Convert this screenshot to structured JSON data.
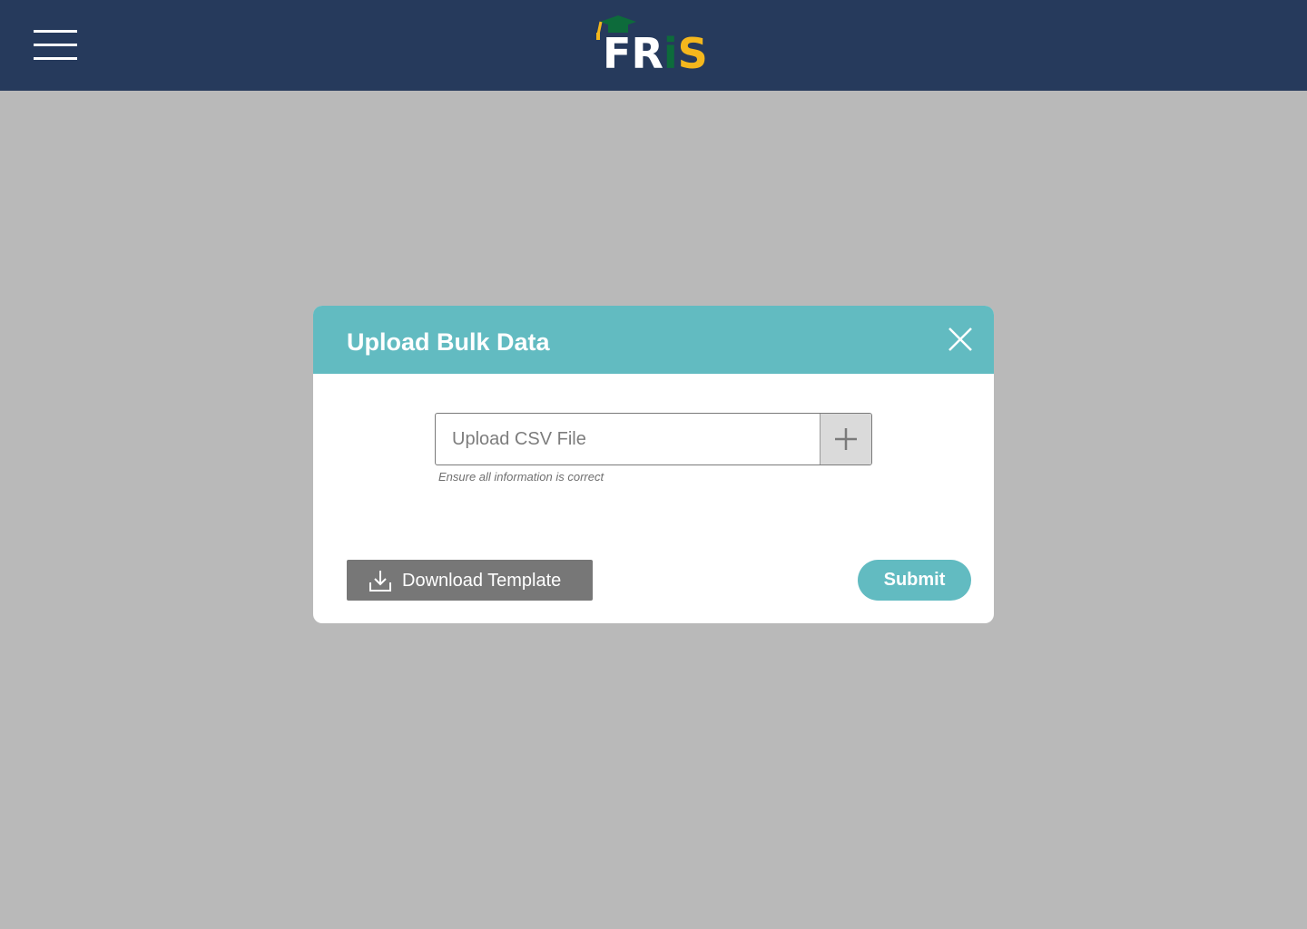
{
  "header": {
    "menu_icon": "hamburger-menu-icon",
    "logo": {
      "letters": [
        "F",
        "R",
        "i",
        "S"
      ],
      "cap_icon": "graduation-cap-icon",
      "colors": {
        "white": "#ffffff",
        "green": "#0d6b3b",
        "yellow": "#f4b71d"
      }
    }
  },
  "modal": {
    "title": "Upload Bulk Data",
    "close_icon": "close-icon",
    "upload": {
      "label": "Upload CSV File",
      "add_icon": "plus-icon",
      "hint": "Ensure all information is correct"
    },
    "download_button": {
      "label": "Download Template",
      "icon": "download-icon"
    },
    "submit_button": {
      "label": "Submit"
    }
  },
  "colors": {
    "topbar": "#263a5c",
    "accent": "#62bbc1",
    "backdrop": "#b9b9b9",
    "download_button": "#777777"
  }
}
